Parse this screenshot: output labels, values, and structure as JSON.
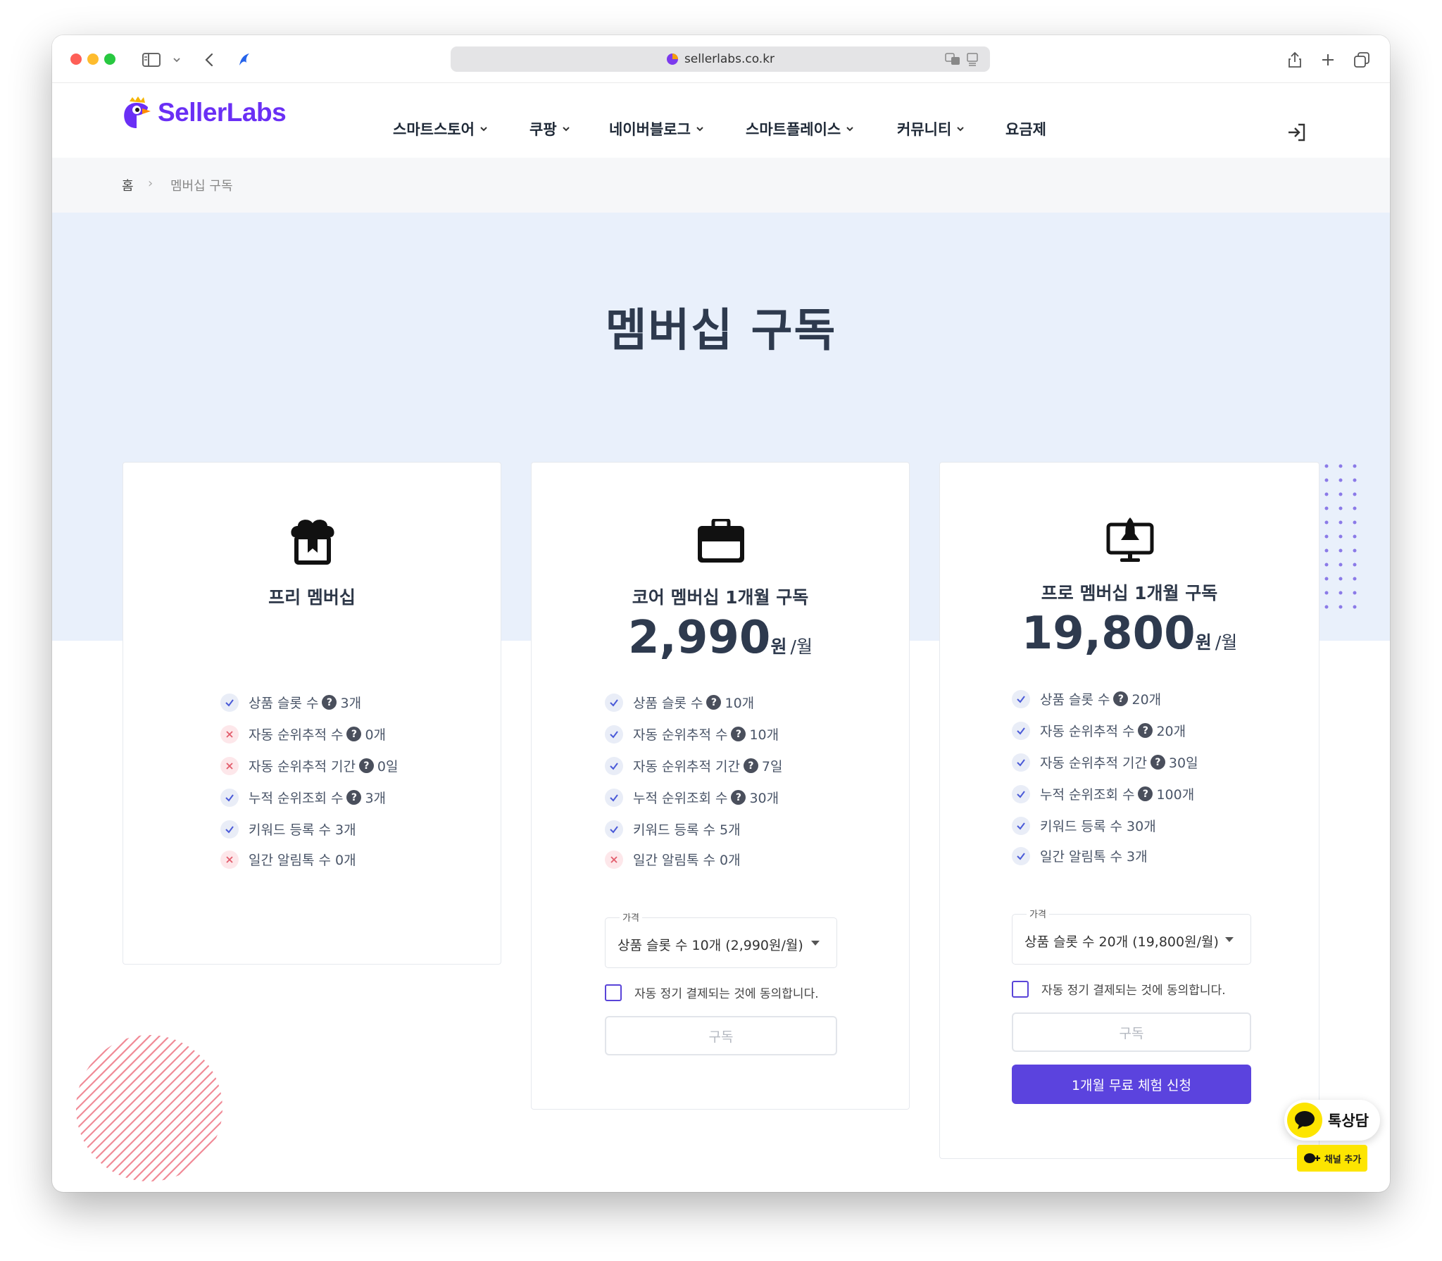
{
  "browser": {
    "url": "sellerlabs.co.kr"
  },
  "header": {
    "logo_text": "SellerLabs",
    "nav": [
      {
        "label": "스마트스토어",
        "has_dropdown": true
      },
      {
        "label": "쿠팡",
        "has_dropdown": true
      },
      {
        "label": "네이버블로그",
        "has_dropdown": true
      },
      {
        "label": "스마트플레이스",
        "has_dropdown": true
      },
      {
        "label": "커뮤니티",
        "has_dropdown": true
      },
      {
        "label": "요금제",
        "has_dropdown": false
      }
    ]
  },
  "breadcrumb": {
    "home": "홈",
    "separator": "›",
    "current": "멤버십 구독"
  },
  "page_title": "멤버십 구독",
  "plans": [
    {
      "title": "프리 멤버십",
      "icon": "chef-hat-icon",
      "features": [
        {
          "label": "상품 슬롯 수",
          "help": true,
          "value": "3개",
          "included": true
        },
        {
          "label": "자동 순위추적 수",
          "help": true,
          "value": "0개",
          "included": false
        },
        {
          "label": "자동 순위추적 기간",
          "help": true,
          "value": "0일",
          "included": false
        },
        {
          "label": "누적 순위조회 수",
          "help": true,
          "value": "3개",
          "included": true
        },
        {
          "label": "키워드 등록 수",
          "help": false,
          "value": "3개",
          "included": true
        },
        {
          "label": "일간 알림톡 수",
          "help": false,
          "value": "0개",
          "included": false
        }
      ]
    },
    {
      "title": "코어 멤버십 1개월 구독",
      "icon": "briefcase-icon",
      "price": "2,990",
      "price_unit": "원",
      "price_period": "/월",
      "features": [
        {
          "label": "상품 슬롯 수",
          "help": true,
          "value": "10개",
          "included": true
        },
        {
          "label": "자동 순위추적 수",
          "help": true,
          "value": "10개",
          "included": true
        },
        {
          "label": "자동 순위추적 기간",
          "help": true,
          "value": "7일",
          "included": true
        },
        {
          "label": "누적 순위조회 수",
          "help": true,
          "value": "30개",
          "included": true
        },
        {
          "label": "키워드 등록 수",
          "help": false,
          "value": "5개",
          "included": true
        },
        {
          "label": "일간 알림톡 수",
          "help": false,
          "value": "0개",
          "included": false
        }
      ],
      "select_label": "가격",
      "select_value": "상품 슬롯 수 10개 (2,990원/월)",
      "agree_label": "자동 정기 결제되는 것에 동의합니다.",
      "subscribe_label": "구독"
    },
    {
      "title": "프로 멤버십 1개월 구독",
      "icon": "rocket-monitor-icon",
      "price": "19,800",
      "price_unit": "원",
      "price_period": "/월",
      "features": [
        {
          "label": "상품 슬롯 수",
          "help": true,
          "value": "20개",
          "included": true
        },
        {
          "label": "자동 순위추적 수",
          "help": true,
          "value": "20개",
          "included": true
        },
        {
          "label": "자동 순위추적 기간",
          "help": true,
          "value": "30일",
          "included": true
        },
        {
          "label": "누적 순위조회 수",
          "help": true,
          "value": "100개",
          "included": true
        },
        {
          "label": "키워드 등록 수",
          "help": false,
          "value": "30개",
          "included": true
        },
        {
          "label": "일간 알림톡 수",
          "help": false,
          "value": "3개",
          "included": true
        }
      ],
      "select_label": "가격",
      "select_value": "상품 슬롯 수 20개 (19,800원/월)",
      "agree_label": "자동 정기 결제되는 것에 동의합니다.",
      "subscribe_label": "구독",
      "trial_label": "1개월 무료 체험 신청"
    }
  ],
  "chat_widget": {
    "label": "톡상담",
    "add_channel": "채널 추가"
  },
  "colors": {
    "brand": "#6a2ff5",
    "primary_button": "#5b43de",
    "hero_bg": "#e9f0fb",
    "check_icon": "#4a5ad8",
    "cross_icon": "#e25c6b",
    "kakao": "#fde500"
  }
}
